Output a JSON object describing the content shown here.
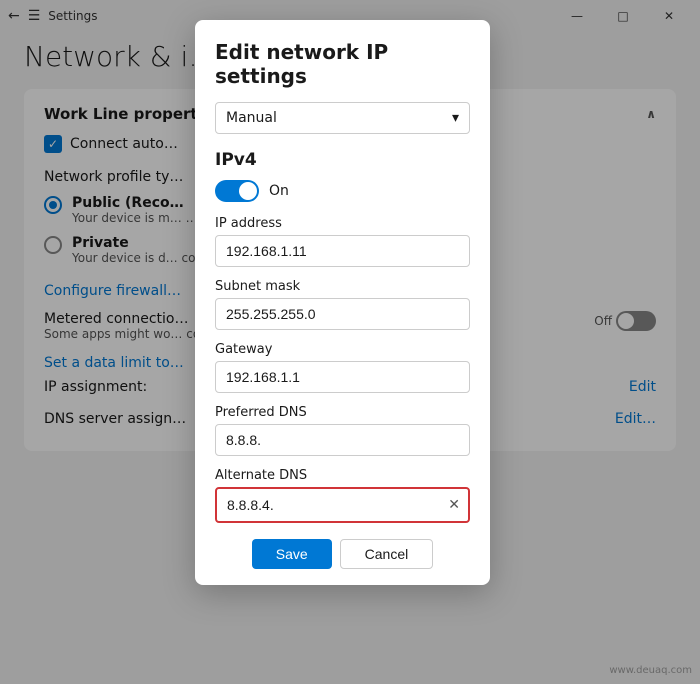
{
  "titlebar": {
    "title": "Settings",
    "back_icon": "←",
    "menu_icon": "☰",
    "minimize_icon": "—",
    "maximize_icon": "□",
    "close_icon": "✕"
  },
  "page": {
    "title": "Network & i…  …ine"
  },
  "sidebar": {
    "section_label": "Work Line properties"
  },
  "connect_auto": {
    "label": "Connect auto…"
  },
  "network_profile": {
    "label": "Network profile ty…",
    "public": {
      "label": "Public (Reco…",
      "desc": "Your device is m…  …hen connected to a network at hom…"
    },
    "private": {
      "label": "Private",
      "desc": "Your device is d… communicate o… network."
    },
    "configure_firewall": "Configure firewall…"
  },
  "metered": {
    "title": "Metered connectio…",
    "desc": "Some apps might wo… connected to this ne…",
    "toggle_state": "off"
  },
  "data_limit": {
    "label": "Set a data limit to…"
  },
  "ip_assignment": {
    "label": "IP assignment:",
    "edit": "Edit"
  },
  "dns_assignment": {
    "label": "DNS server assign…",
    "edit": "Edit…"
  },
  "modal": {
    "title": "Edit network IP settings",
    "dropdown": {
      "value": "Manual",
      "chevron": "▾"
    },
    "ipv4": {
      "title": "IPv4",
      "toggle_label": "On"
    },
    "fields": {
      "ip_address": {
        "label": "IP address",
        "value": "192.168.1.11"
      },
      "subnet_mask": {
        "label": "Subnet mask",
        "value": "255.255.255.0"
      },
      "gateway": {
        "label": "Gateway",
        "value": "192.168.1.1"
      },
      "preferred_dns": {
        "label": "Preferred DNS",
        "value": "8.8.8."
      },
      "alternate_dns": {
        "label": "Alternate DNS",
        "value": "8.8.8.4."
      }
    },
    "save_btn": "Save",
    "cancel_btn": "Cancel"
  },
  "watermark": "www.deuaq.com"
}
